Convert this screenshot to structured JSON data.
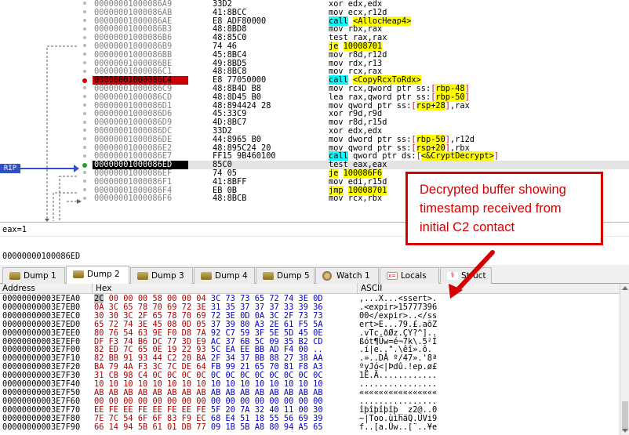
{
  "disasm": [
    {
      "addr": "00000001000086A9",
      "bytes": "33D2",
      "parts": [
        [
          "xor edx,edx",
          ""
        ]
      ]
    },
    {
      "addr": "00000001000086AB",
      "bytes": "41:8BCC",
      "parts": [
        [
          "mov ecx,r12d",
          ""
        ]
      ]
    },
    {
      "addr": "00000001000086AE",
      "bytes": "E8 ADF80000",
      "parts": [
        [
          "call",
          "call"
        ],
        [
          " ",
          ""
        ],
        [
          "<AllocHeap4>",
          "y"
        ]
      ]
    },
    {
      "addr": "00000001000086B3",
      "bytes": "48:8BD8",
      "parts": [
        [
          "mov rbx,rax",
          ""
        ]
      ]
    },
    {
      "addr": "00000001000086B6",
      "bytes": "48:85C0",
      "parts": [
        [
          "test rax,rax",
          ""
        ]
      ]
    },
    {
      "addr": "00000001000086B9",
      "bytes": "74 46",
      "parts": [
        [
          "je",
          "je"
        ],
        [
          " ",
          ""
        ],
        [
          "10008701",
          "y"
        ]
      ]
    },
    {
      "addr": "00000001000086BB",
      "bytes": "45:8BC4",
      "parts": [
        [
          "mov r8d,r12d",
          ""
        ]
      ]
    },
    {
      "addr": "00000001000086BE",
      "bytes": "49:8BD5",
      "parts": [
        [
          "mov rdx,r13",
          ""
        ]
      ]
    },
    {
      "addr": "00000001000086C1",
      "bytes": "48:8BC8",
      "parts": [
        [
          "mov rcx,rax",
          ""
        ]
      ]
    },
    {
      "addr": "00000001000086C4",
      "bytes": "E8 77050000",
      "parts": [
        [
          "call",
          "call"
        ],
        [
          " ",
          ""
        ],
        [
          "<CopyRcxToRdx>",
          "y"
        ]
      ],
      "bp": true
    },
    {
      "addr": "00000001000086C9",
      "bytes": "48:8B4D B8",
      "parts": [
        [
          "mov rcx,qword ptr ss:",
          ""
        ],
        [
          "[",
          "br"
        ],
        [
          "rbp-48",
          "y"
        ],
        [
          "]",
          "br"
        ]
      ]
    },
    {
      "addr": "00000001000086CD",
      "bytes": "48:8D45 B0",
      "parts": [
        [
          "lea rax,qword ptr ss:",
          ""
        ],
        [
          "[",
          "br"
        ],
        [
          "rbp-50",
          "y"
        ],
        [
          "]",
          "br"
        ]
      ]
    },
    {
      "addr": "00000001000086D1",
      "bytes": "48:894424 28",
      "parts": [
        [
          "mov qword ptr ss:",
          ""
        ],
        [
          "[",
          "br"
        ],
        [
          "rsp+28",
          "y"
        ],
        [
          "]",
          "br"
        ],
        [
          ",rax",
          ""
        ]
      ]
    },
    {
      "addr": "00000001000086D6",
      "bytes": "45:33C9",
      "parts": [
        [
          "xor r9d,r9d",
          ""
        ]
      ]
    },
    {
      "addr": "00000001000086D9",
      "bytes": "4D:8BC7",
      "parts": [
        [
          "mov r8d,r15d",
          ""
        ]
      ]
    },
    {
      "addr": "00000001000086DC",
      "bytes": "33D2",
      "parts": [
        [
          "xor edx,edx",
          ""
        ]
      ]
    },
    {
      "addr": "00000001000086DE",
      "bytes": "44:8965 B0",
      "parts": [
        [
          "mov dword ptr ss:",
          ""
        ],
        [
          "[",
          "br"
        ],
        [
          "rbp-50",
          "y"
        ],
        [
          "]",
          "br"
        ],
        [
          ",r12d",
          ""
        ]
      ]
    },
    {
      "addr": "00000001000086E2",
      "bytes": "48:895C24 20",
      "parts": [
        [
          "mov qword ptr ss:",
          ""
        ],
        [
          "[",
          "br"
        ],
        [
          "rsp+20",
          "y"
        ],
        [
          "]",
          "br"
        ],
        [
          ",rbx",
          ""
        ]
      ]
    },
    {
      "addr": "00000001000086E7",
      "bytes": "FF15 9B460100",
      "parts": [
        [
          "call",
          "call"
        ],
        [
          " qword ptr ds:",
          ""
        ],
        [
          "[",
          "br"
        ],
        [
          "<&CryptDecrypt>",
          "y"
        ],
        [
          "]",
          "br"
        ]
      ]
    },
    {
      "addr": "00000001000086ED",
      "bytes": "85C0",
      "parts": [
        [
          "test eax,eax",
          ""
        ]
      ],
      "cur": true
    },
    {
      "addr": "00000001000086EF",
      "bytes": "74 05",
      "parts": [
        [
          "je",
          "je"
        ],
        [
          " ",
          ""
        ],
        [
          "100086F6",
          "y"
        ]
      ]
    },
    {
      "addr": "00000001000086F1",
      "bytes": "41:8BFF",
      "parts": [
        [
          "mov edi,r15d",
          ""
        ]
      ]
    },
    {
      "addr": "00000001000086F4",
      "bytes": "EB 0B",
      "parts": [
        [
          "jmp",
          "jmp"
        ],
        [
          " ",
          ""
        ],
        [
          "10008701",
          "y"
        ]
      ]
    },
    {
      "addr": "00000001000086F6",
      "bytes": "48:8BCB",
      "parts": [
        [
          "mov rcx,rbx",
          ""
        ]
      ]
    }
  ],
  "rip_label": "RIP",
  "info": {
    "line1": "eax=1",
    "line2": "00000000100086ED"
  },
  "tabs": [
    {
      "label": "Dump 1",
      "icon": "dump-icon"
    },
    {
      "label": "Dump 2",
      "icon": "dump-icon",
      "active": true
    },
    {
      "label": "Dump 3",
      "icon": "dump-icon"
    },
    {
      "label": "Dump 4",
      "icon": "dump-icon"
    },
    {
      "label": "Dump 5",
      "icon": "dump-icon"
    },
    {
      "label": "Watch 1",
      "icon": "watch-icon"
    },
    {
      "label": "Locals",
      "icon": "locals-icon"
    },
    {
      "label": "Struct",
      "icon": "struct-icon"
    }
  ],
  "dump_header": {
    "address": "Address",
    "hex": "Hex",
    "ascii": "ASCII"
  },
  "dump_rows": [
    {
      "addr": "00000000003E7EA0",
      "hex": "2C 00 00 00 58 00 00 04 3C 73 73 65 72 74 3E 0D",
      "ascii": ",...X...<ssert>."
    },
    {
      "addr": "00000000003E7EB0",
      "hex": "0A 3C 65 78 70 69 72 3E 31 35 37 37 37 33 39 36",
      "ascii": ".<expir>15777396"
    },
    {
      "addr": "00000000003E7EC0",
      "hex": "30 30 3C 2F 65 78 70 69 72 3E 0D 0A 3C 2F 73 73",
      "ascii": "00</expir>..</ss"
    },
    {
      "addr": "00000000003E7ED0",
      "hex": "65 72 74 3E 45 08 0D 05 37 39 80 A3 2E 61 F5 5A",
      "ascii": "ert>E...79.£.aõZ"
    },
    {
      "addr": "00000000003E7EE0",
      "hex": "80 76 54 63 9E F0 D8 7A 92 C7 59 3F 5E 5D 45 0E",
      "ascii": ".vTc.ðØz.ÇY?^].."
    },
    {
      "addr": "00000000003E7EF0",
      "hex": "DF F3 74 B6 DC 77 3D E9 AC 37 6B 5C 09 35 B2 CD",
      "ascii": "ßót¶Üw=é¬7k\\.5²Í"
    },
    {
      "addr": "00000000003E7F00",
      "hex": "82 ED 7C 65 0E 19 22 93 5C EA EE BB AD F4 00 ..",
      "ascii": ".í|e..\".\\êî».ô."
    },
    {
      "addr": "00000000003E7F10",
      "hex": "82 BB 91 93 44 C2 20 BA 2F 34 37 BB 88 27 38 AA",
      "ascii": ".»..DÂ º/47».'8ª"
    },
    {
      "addr": "00000000003E7F20",
      "hex": "BA 79 4A F3 3C 7C DE 64 FB 99 21 65 70 81 F8 A3",
      "ascii": "ºyJó<|Þdû.!ep.ø£"
    },
    {
      "addr": "00000000003E7F30",
      "hex": "31 CB 98 C4 0C 0C 0C 0C 0C 0C 0C 0C 0C 0C 0C 0C",
      "ascii": "1Ë.Ä............"
    },
    {
      "addr": "00000000003E7F40",
      "hex": "10 10 10 10 10 10 10 10 10 10 10 10 10 10 10 10",
      "ascii": "................"
    },
    {
      "addr": "00000000003E7F50",
      "hex": "AB AB AB AB AB AB AB AB AB AB AB AB AB AB AB AB",
      "ascii": "««««««««««««««««"
    },
    {
      "addr": "00000000003E7F60",
      "hex": "00 00 00 00 00 00 00 00 00 00 00 00 00 00 00 00",
      "ascii": "................"
    },
    {
      "addr": "00000000003E7F70",
      "hex": "EE FE EE FE EE FE EE FE 5F 20 7A 32 40 11 00 30",
      "ascii": "îþîþîþîþ_ z2@..0"
    },
    {
      "addr": "00000000003E7F80",
      "hex": "7E 7C 54 6F 6F 83 F9 EC 68 E4 51 18 55 56 69 39",
      "ascii": "~|Too.ùìhäQ.UVi9"
    },
    {
      "addr": "00000000003E7F90",
      "hex": "66 14 94 5B 61 01 DB 77 09 1B 5B A8 80 94 A5 65",
      "ascii": "f..[a.Ûw..[¨..¥e"
    }
  ],
  "callout": {
    "lines": [
      "Decrypted buffer showing",
      "timestamp received from",
      "initial C2 contact"
    ]
  },
  "colors": {
    "callout": "#d40000",
    "rip": "#3050c8",
    "breakpoint": "#cc0000",
    "highlight": "#ffff00",
    "call": "#00ffff"
  }
}
